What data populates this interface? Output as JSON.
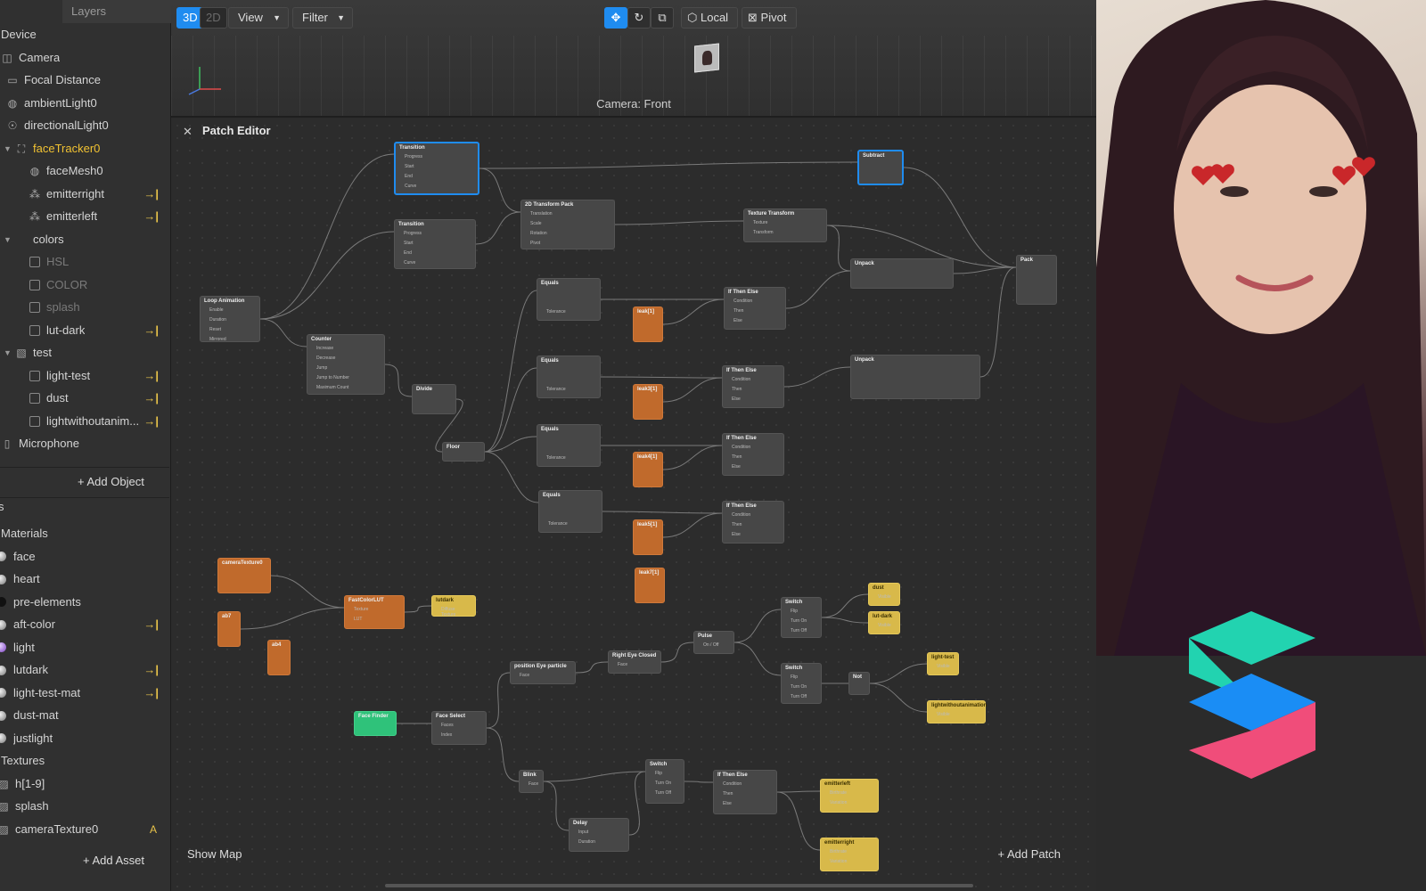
{
  "layers_tab": "Layers",
  "scene": [
    {
      "label": "Device",
      "icon": "none",
      "indent": 0
    },
    {
      "label": "Camera",
      "icon": "camera-icon",
      "indent": 0
    },
    {
      "label": "Focal Distance",
      "icon": "ruler-icon",
      "indent": 1
    },
    {
      "label": "ambientLight0",
      "icon": "globe-icon",
      "indent": 1
    },
    {
      "label": "directionalLight0",
      "icon": "light-icon",
      "indent": 1
    },
    {
      "label": "faceTracker0",
      "icon": "face-tracker-icon",
      "indent": 1,
      "selected": true,
      "tri": true
    },
    {
      "label": "faceMesh0",
      "icon": "globe-icon",
      "indent": 2
    },
    {
      "label": "emitterright",
      "icon": "emitter-icon",
      "indent": 2,
      "arrow": true
    },
    {
      "label": "emitterleft",
      "icon": "emitter-icon",
      "indent": 2,
      "arrow": true
    },
    {
      "label": "colors",
      "icon": "folder-icon",
      "indent": 1,
      "tri": true
    },
    {
      "label": "HSL",
      "icon": "square-icon",
      "indent": 2,
      "dim": true
    },
    {
      "label": "COLOR",
      "icon": "square-icon",
      "indent": 2,
      "dim": true
    },
    {
      "label": "splash",
      "icon": "square-icon",
      "indent": 2,
      "dim": true
    },
    {
      "label": "lut-dark",
      "icon": "square-icon",
      "indent": 2,
      "arrow": true
    },
    {
      "label": "test",
      "icon": "canvas-icon",
      "indent": 1,
      "tri": true
    },
    {
      "label": "light-test",
      "icon": "square-icon",
      "indent": 2,
      "arrow": true
    },
    {
      "label": "dust",
      "icon": "square-icon",
      "indent": 2,
      "arrow": true
    },
    {
      "label": "lightwithoutanim...",
      "icon": "square-icon",
      "indent": 2,
      "arrow": true
    },
    {
      "label": "Microphone",
      "icon": "mic-icon",
      "indent": 0
    }
  ],
  "add_object": "+ Add Object",
  "assets_head": "s",
  "assets": [
    {
      "label": "Materials",
      "kind": "header"
    },
    {
      "label": "face",
      "kind": "material"
    },
    {
      "label": "heart",
      "kind": "material"
    },
    {
      "label": "pre-elements",
      "kind": "material-dark"
    },
    {
      "label": "aft-color",
      "kind": "material",
      "arrow": true
    },
    {
      "label": "light",
      "kind": "material-purple"
    },
    {
      "label": "lutdark",
      "kind": "material",
      "arrow": true
    },
    {
      "label": "light-test-mat",
      "kind": "material",
      "arrow": true
    },
    {
      "label": "dust-mat",
      "kind": "material"
    },
    {
      "label": "justlight",
      "kind": "material"
    },
    {
      "label": "Textures",
      "kind": "header"
    },
    {
      "label": "h[1-9]",
      "kind": "texture"
    },
    {
      "label": "splash",
      "kind": "texture"
    },
    {
      "label": "cameraTexture0",
      "kind": "texture",
      "badge": "A"
    }
  ],
  "add_asset": "+ Add Asset",
  "toolbar": {
    "mode_3d": "3D",
    "mode_2d": "2D",
    "view": "View",
    "filter": "Filter",
    "local": "Local",
    "pivot": "Pivot"
  },
  "camera_label": "Camera: Front",
  "patch_editor": {
    "title": "Patch Editor",
    "show_map": "Show Map",
    "add_patch": "+ Add Patch",
    "nodes": [
      {
        "title": "Transition",
        "kind": "gray",
        "props": [
          "Progress",
          "Start",
          "End",
          "Curve"
        ],
        "selected": true
      },
      {
        "title": "Transition",
        "kind": "gray",
        "props": [
          "Progress",
          "Start",
          "End",
          "Curve"
        ]
      },
      {
        "title": "2D Transform Pack",
        "kind": "gray",
        "props": [
          "Translation",
          "Scale",
          "Rotation",
          "Pivot"
        ]
      },
      {
        "title": "Texture Transform",
        "kind": "gray",
        "props": [
          "Texture",
          "Transform"
        ]
      },
      {
        "title": "Subtract",
        "kind": "gray",
        "props": [
          "",
          ""
        ],
        "selected": true
      },
      {
        "title": "Unpack",
        "kind": "gray",
        "props": [
          ""
        ]
      },
      {
        "title": "Pack",
        "kind": "gray",
        "props": [
          "",
          "",
          "",
          ""
        ]
      },
      {
        "title": "Unpack",
        "kind": "gray",
        "props": [
          ""
        ]
      },
      {
        "title": "Loop Animation",
        "kind": "gray",
        "props": [
          "Enable",
          "Duration",
          "Reset",
          "Mirrored"
        ]
      },
      {
        "title": "Counter",
        "kind": "gray",
        "props": [
          "Increase",
          "Decrease",
          "Jump",
          "Jump to Number",
          "Maximum Count"
        ]
      },
      {
        "title": "Divide",
        "kind": "gray",
        "props": [
          "",
          ""
        ]
      },
      {
        "title": "Floor",
        "kind": "gray",
        "props": [
          ""
        ]
      },
      {
        "title": "Equals",
        "kind": "gray",
        "props": [
          "",
          "",
          "Tolerance"
        ]
      },
      {
        "title": "Equals",
        "kind": "gray",
        "props": [
          "",
          "",
          "Tolerance"
        ]
      },
      {
        "title": "Equals",
        "kind": "gray",
        "props": [
          "",
          "",
          "Tolerance"
        ]
      },
      {
        "title": "Equals",
        "kind": "gray",
        "props": [
          "",
          "",
          "Tolerance"
        ]
      },
      {
        "title": "leak[1]",
        "kind": "orange",
        "props": []
      },
      {
        "title": "leak3[1]",
        "kind": "orange",
        "props": []
      },
      {
        "title": "leak4[1]",
        "kind": "orange",
        "props": []
      },
      {
        "title": "leak5[1]",
        "kind": "orange",
        "props": []
      },
      {
        "title": "leak7[1]",
        "kind": "orange",
        "props": []
      },
      {
        "title": "If Then Else",
        "kind": "gray",
        "props": [
          "Condition",
          "Then",
          "Else"
        ]
      },
      {
        "title": "If Then Else",
        "kind": "gray",
        "props": [
          "Condition",
          "Then",
          "Else"
        ]
      },
      {
        "title": "If Then Else",
        "kind": "gray",
        "props": [
          "Condition",
          "Then",
          "Else"
        ]
      },
      {
        "title": "If Then Else",
        "kind": "gray",
        "props": [
          "Condition",
          "Then",
          "Else"
        ]
      },
      {
        "title": "cameraTexture0",
        "kind": "orange",
        "props": []
      },
      {
        "title": "FastColorLUT",
        "kind": "orange",
        "props": [
          "Texture",
          "LUT"
        ]
      },
      {
        "title": "lutdark",
        "kind": "yellow",
        "props": [
          "Diffuse Texture"
        ]
      },
      {
        "title": "ab7",
        "kind": "orange",
        "props": []
      },
      {
        "title": "ab4",
        "kind": "orange",
        "props": []
      },
      {
        "title": "Switch",
        "kind": "gray",
        "props": [
          "Flip",
          "Turn On",
          "Turn Off"
        ]
      },
      {
        "title": "dust",
        "kind": "yellow",
        "props": [
          "Visible"
        ]
      },
      {
        "title": "lut-dark",
        "kind": "yellow",
        "props": [
          "Visible"
        ]
      },
      {
        "title": "Pulse",
        "kind": "gray",
        "props": [
          "On / Off"
        ]
      },
      {
        "title": "Right Eye Closed",
        "kind": "gray",
        "props": [
          "Face"
        ]
      },
      {
        "title": "position Eye particle",
        "kind": "gray",
        "props": [
          "Face"
        ]
      },
      {
        "title": "Switch",
        "kind": "gray",
        "props": [
          "Flip",
          "Turn On",
          "Turn Off"
        ]
      },
      {
        "title": "Not",
        "kind": "gray",
        "props": [
          ""
        ]
      },
      {
        "title": "light-test",
        "kind": "yellow",
        "props": [
          "Visible"
        ]
      },
      {
        "title": "lightwithoutanimation",
        "kind": "yellow",
        "props": [
          "Visible"
        ]
      },
      {
        "title": "Face Finder",
        "kind": "green",
        "props": []
      },
      {
        "title": "Face Select",
        "kind": "gray",
        "props": [
          "Faces",
          "Index"
        ]
      },
      {
        "title": "Blink",
        "kind": "gray",
        "props": [
          "Face"
        ]
      },
      {
        "title": "Switch",
        "kind": "gray",
        "props": [
          "Flip",
          "Turn On",
          "Turn Off"
        ]
      },
      {
        "title": "If Then Else",
        "kind": "gray",
        "props": [
          "Condition",
          "Then",
          "Else"
        ]
      },
      {
        "title": "emitterleft",
        "kind": "yellow",
        "props": [
          "Birthrate",
          "Variation"
        ]
      },
      {
        "title": "Delay",
        "kind": "gray",
        "props": [
          "Input",
          "Duration"
        ]
      },
      {
        "title": "emitterright",
        "kind": "yellow",
        "props": [
          "Birthrate",
          "Variation"
        ]
      }
    ]
  },
  "colors": {
    "accent": "#1f8cf0",
    "selected_text": "#f1c232",
    "logo_teal": "#22d3b0",
    "logo_blue": "#1a8df5",
    "logo_pink": "#f04d7a"
  }
}
